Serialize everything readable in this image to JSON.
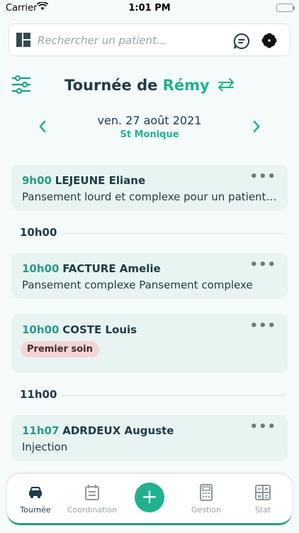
{
  "status_bar": {
    "carrier": "Carrier",
    "time": "1:01 PM"
  },
  "search": {
    "placeholder": "Rechercher un patient..."
  },
  "header": {
    "title_prefix": "Tournée de",
    "title_name": "Rémy"
  },
  "date_nav": {
    "date": "ven. 27 août 2021",
    "location": "St Monique"
  },
  "sections": [
    {
      "label": "10h00"
    },
    {
      "label": "11h00"
    }
  ],
  "visits": [
    {
      "time": "9h00",
      "patient": "LEJEUNE Eliane",
      "description": "Pansement lourd et complexe pour un patient diabétique"
    },
    {
      "time": "10h00",
      "patient": "FACTURE Amelie",
      "description": "Pansement complexe Pansement complexe"
    },
    {
      "time": "10h00",
      "patient": "COSTE Louis",
      "badge": "Premier soin"
    },
    {
      "time": "11h07",
      "patient": "ADRDEUX Auguste",
      "description": "Injection"
    }
  ],
  "tabs": [
    {
      "label": "Tournée",
      "icon": "car-icon",
      "active": true
    },
    {
      "label": "Coordination",
      "icon": "calendar-icon"
    },
    {
      "label": "Gestion",
      "icon": "calculator-icon"
    },
    {
      "label": "Stat",
      "icon": "stats-icon"
    }
  ],
  "colors": {
    "accent": "#21b28f",
    "card_bg": "#e8f4f2",
    "badge_bg": "#f5d4d4",
    "text": "#1f3b47"
  }
}
